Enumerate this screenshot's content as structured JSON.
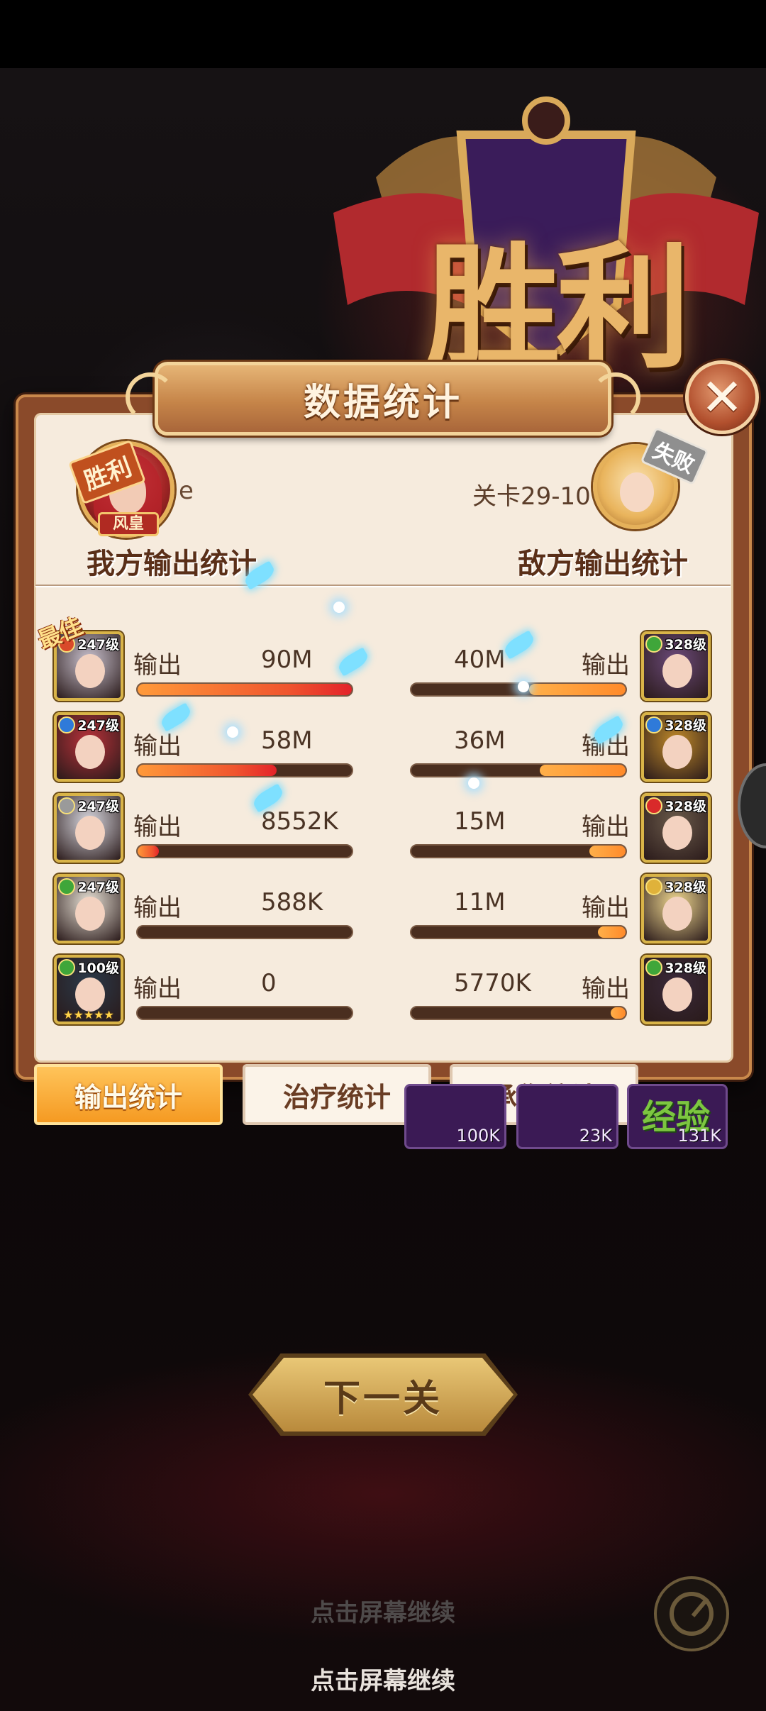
{
  "victory_banner": {
    "text": "胜利"
  },
  "dialog": {
    "title": "数据统计",
    "close_symbol": "✕",
    "player": {
      "name_fragment": "e",
      "badge": "胜利",
      "avatar_tag": "风皇"
    },
    "enemy": {
      "stage": "关卡29-10",
      "badge": "失败"
    },
    "ally_header": "我方输出统计",
    "enemy_header": "敌方输出统计",
    "best_label": "最佳",
    "rows": [
      {
        "ally": {
          "level": "247级",
          "label": "输出",
          "value": "90M",
          "fill": 1.0,
          "elem_color": "#d94a2a",
          "portrait_color": "#c9c2cf",
          "stars": ""
        },
        "enemy": {
          "level": "328级",
          "label": "输出",
          "value": "40M",
          "fill": 0.45,
          "elem_color": "#3fa63a",
          "portrait_color": "#6b4a7a",
          "stars": ""
        }
      },
      {
        "ally": {
          "level": "247级",
          "label": "输出",
          "value": "58M",
          "fill": 0.65,
          "elem_color": "#2f7ad9",
          "portrait_color": "#b8323a",
          "stars": ""
        },
        "enemy": {
          "level": "328级",
          "label": "输出",
          "value": "36M",
          "fill": 0.4,
          "elem_color": "#2f7ad9",
          "portrait_color": "#c08a2a",
          "stars": ""
        }
      },
      {
        "ally": {
          "level": "247级",
          "label": "输出",
          "value": "8552K",
          "fill": 0.1,
          "elem_color": "#9a9a9a",
          "portrait_color": "#d8d8e0",
          "stars": ""
        },
        "enemy": {
          "level": "328级",
          "label": "输出",
          "value": "15M",
          "fill": 0.17,
          "elem_color": "#d92a2a",
          "portrait_color": "#6a5a4a",
          "stars": ""
        }
      },
      {
        "ally": {
          "level": "247级",
          "label": "输出",
          "value": "588K",
          "fill": 0.0,
          "elem_color": "#3fa63a",
          "portrait_color": "#e8e2d6",
          "stars": ""
        },
        "enemy": {
          "level": "328级",
          "label": "输出",
          "value": "11M",
          "fill": 0.13,
          "elem_color": "#e0b23a",
          "portrait_color": "#f0d890",
          "stars": ""
        }
      },
      {
        "ally": {
          "level": "100级",
          "label": "输出",
          "value": "0",
          "fill": 0.0,
          "elem_color": "#3fa63a",
          "portrait_color": "#2a3a4a",
          "stars": "★★★★★"
        },
        "enemy": {
          "level": "328级",
          "label": "输出",
          "value": "5770K",
          "fill": 0.07,
          "elem_color": "#3fa63a",
          "portrait_color": "#3a2a3a",
          "stars": ""
        }
      }
    ],
    "tabs": [
      "输出统计",
      "治疗统计",
      "承伤统计"
    ]
  },
  "rewards": [
    {
      "amount": "100K"
    },
    {
      "amount": "23K"
    },
    {
      "label": "经验",
      "amount": "131K"
    }
  ],
  "next_button": "下一关",
  "hint_ghost": "点击屏幕继续",
  "hint": "点击屏幕继续"
}
